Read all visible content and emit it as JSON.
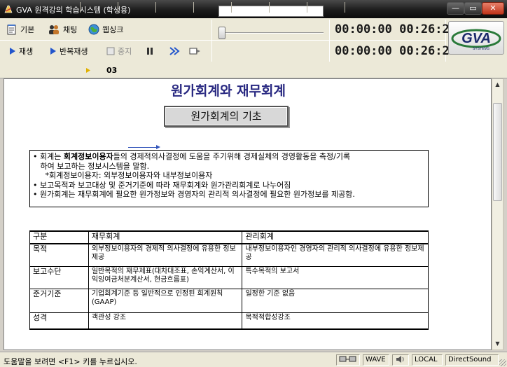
{
  "window": {
    "title": "GVA 원격강의 학습시스템 (학생용)",
    "min_glyph": "—",
    "max_glyph": "▭",
    "close_glyph": "✕"
  },
  "toolbar": {
    "basic_label": "기본",
    "chat_label": "채팅",
    "weblink_label": "웹싱크",
    "play_label": "재생",
    "repeat_label": "반복재생",
    "stop_label": "중지",
    "pause_glyph": "⏸",
    "ffwd_glyph": "»"
  },
  "timers": {
    "top": "00:00:00 00:26:25",
    "bottom": "00:00:00 00:26:25"
  },
  "logo": {
    "text": "GVA",
    "sub": "SYSTEMS"
  },
  "chapter": {
    "number": "03"
  },
  "lesson": {
    "title": "원가회계와 재무회계",
    "subtitle": "원가회계의 기초",
    "line1_pre": "•  회계는 ",
    "line1_bold": "회계정보이용자",
    "line1_post": "들의 경제적의사결정에 도움을 주기위해 경제실체의 경영활동을 측정/기록",
    "line2": "   하여 보고하는 정보시스템을 말함.",
    "line3": "     *회계정보이용자: 외부정보이용자와 내부정보이용자",
    "line4": "• 보고목적과 보고대상 및 준거기준에 따라 재무회계와 원가관리회계로 나누어짐",
    "line5": "• 원가회계는 재무회계에 필요한 원가정보와 경영자의 관리적 의사결정에 필요한 원가정보를 제공함."
  },
  "table": {
    "headers": [
      "구분",
      "재무회계",
      "관리회계"
    ],
    "rows": [
      [
        "목적",
        "외부정보이용자의 경제적 의사결정에 유용한 정보제공",
        "내부정보이용자인 경영자의 관리적 의사결정에 유용한 정보제공"
      ],
      [
        "보고수단",
        "일반목적의 재무제표(대차대조표, 손익계산서, 이익잉여금처분계산서, 현금흐름표)",
        "특수목적의 보고서"
      ],
      [
        "준거기준",
        "기업회계기준 등 일반적으로 인정된 회계원칙(GAAP)",
        "일정한 기준 없음"
      ],
      [
        "성격",
        "객관성 강조",
        "목적적합성강조"
      ]
    ]
  },
  "status": {
    "help": "도움말을 보려면 <F1> 키를 누르십시오.",
    "wave": "WAVE",
    "local": "LOCAL",
    "sound": "DirectSound"
  },
  "colors": {
    "title_text": "#2a2a82",
    "arrow": "#3355bb",
    "play_icon": "#2255cc"
  }
}
